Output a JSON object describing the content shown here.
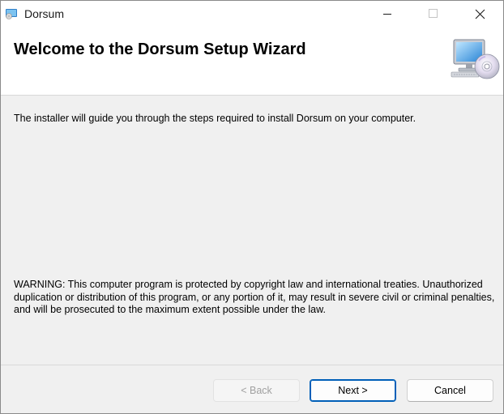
{
  "window": {
    "title": "Dorsum",
    "controls": {
      "minimize_icon": "minimize-icon",
      "maximize_icon": "maximize-icon",
      "close_icon": "close-icon"
    }
  },
  "header": {
    "title": "Welcome to the Dorsum Setup Wizard",
    "graphic_icon": "computer-with-disc-icon"
  },
  "body": {
    "intro": "The installer will guide you through the steps required to install Dorsum on your computer.",
    "warning": "WARNING: This computer program is protected by copyright law and international treaties. Unauthorized duplication or distribution of this program, or any portion of it, may result in severe civil or criminal penalties, and will be prosecuted to the maximum extent possible under the law."
  },
  "buttons": {
    "back_label": "< Back",
    "back_enabled": false,
    "next_label": "Next >",
    "cancel_label": "Cancel"
  },
  "colors": {
    "accent": "#005fb8",
    "background": "#f0f0f0",
    "header_background": "#ffffff"
  }
}
